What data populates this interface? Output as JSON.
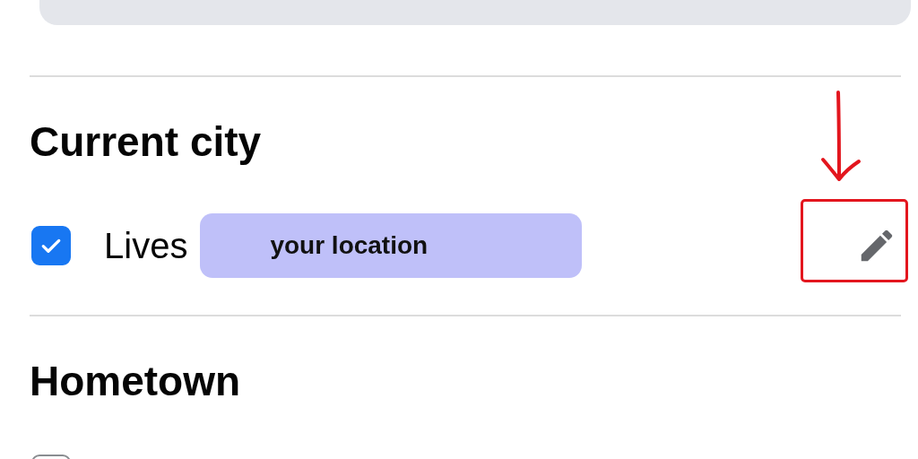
{
  "sections": [
    {
      "heading": "Current city",
      "items": [
        {
          "checked": true,
          "label": "Lives",
          "value": "your location",
          "editable": true
        }
      ]
    },
    {
      "heading": "Hometown",
      "items": [
        {
          "checked": false
        }
      ]
    }
  ]
}
